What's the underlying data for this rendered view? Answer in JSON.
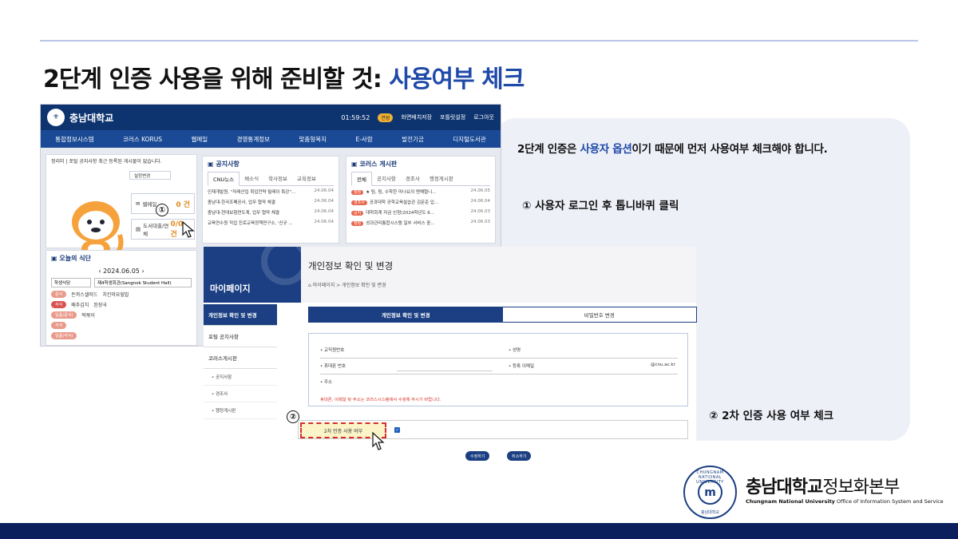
{
  "slide": {
    "title_prefix": "2단계 인증 사용을 위해 준비할 것: ",
    "title_highlight": "사용여부 체크"
  },
  "info": {
    "main_prefix": "2단계 인증은 ",
    "main_highlight": "사용자 옵션",
    "main_suffix": "이기 때문에 먼저 사용여부 체크해야 합니다.",
    "step1": "① 사용자 로그인 후 톱니바퀴 클릭",
    "step2": "② 2차 인증 사용 여부 체크"
  },
  "portal": {
    "univ_name": "충남대학교",
    "clock": "01:59:52",
    "extend": "연장",
    "header_links": [
      "화면배치저장",
      "포틀릿설정",
      "로그아웃"
    ],
    "nav": [
      "통합정보시스템",
      "코러스 KORUS",
      "웹메일",
      "경영통계정보",
      "맞춤형복지",
      "E-사람",
      "발전기금",
      "디지털도서관"
    ],
    "user_notice": "정리미 | 포털 공지사항 최근 등록된 게시물이 없습니다.",
    "step_marker": "①",
    "mail_label": "웹메일",
    "mail_count": "0 건",
    "library_label": "도서대출/연체",
    "library_count": "0/0 건",
    "settings_label": "설정변경",
    "notice": {
      "title": "공지사항",
      "tabs": [
        "CNU뉴스",
        "채소식",
        "학사정보",
        "교육정보"
      ],
      "rows": [
        {
          "text": "인재개발원, \"미래산업 취업전략 릴레이 특강\"...",
          "date": "24.06.04"
        },
        {
          "text": "충남대-한국조폐공사, 업무 협약 체결",
          "date": "24.06.04"
        },
        {
          "text": "충남대-현대보험연도계, 업무 협약 체결",
          "date": "24.06.04"
        },
        {
          "text": "교육연수원 직업 진로교육정책연구소, '신규 ...",
          "date": "24.06.04"
        }
      ]
    },
    "korus": {
      "title": "코러스 게시판",
      "tabs": [
        "전체",
        "공지사항",
        "경조사",
        "행정게시판"
      ],
      "rows": [
        {
          "badge": "행정",
          "text": "★ 팀, 팀, 수학한 미나요의 맨해협니...",
          "date": "24.06.05"
        },
        {
          "badge": "경조사",
          "text": "공과대학 공학교육설습관 김문준 입...",
          "date": "24.06.04"
        },
        {
          "badge": "공지",
          "text": "대학회계 자금 신청(2024학년도 6...",
          "date": "24.06.03"
        },
        {
          "badge": "행정",
          "text": "성과관리통합시스템 일부 서비스 중...",
          "date": "24.06.03"
        }
      ]
    },
    "meal": {
      "title": "오늘의 식단",
      "date": "2024.06.05",
      "place": "학생식당",
      "hall": "제4학생회관(Sangnok Student Hall)",
      "tags": [
        "중식",
        "석식",
        "일품(중식)",
        "석식",
        "일품(석식)"
      ],
      "items_left": [
        "돈까스샐러드",
        "배추김치",
        "떡볶이"
      ],
      "items_right": [
        "치킨마요덮밥",
        "된장국"
      ]
    }
  },
  "mypage": {
    "side_title": "마이페이지",
    "page_title": "개인정보 확인 및 변경",
    "breadcrumb": "마이페이지 > 개인정보 확인 및 변경",
    "menu": [
      {
        "label": "개인정보 확인 및 변경",
        "active": true
      },
      {
        "label": "포털 공지사항",
        "active": false
      },
      {
        "label": "코러스게시판",
        "active": false
      }
    ],
    "submenu": [
      "공지사항",
      "경조사",
      "행정게시판"
    ],
    "tabs": [
      "개인정보 확인 및 변경",
      "비밀번호 변경"
    ],
    "fields": {
      "staff_no": "교직원번호",
      "name": "성명",
      "phone": "휴대폰 번호",
      "email": "등록 이메일",
      "email_domain": "@cnu.ac.kr",
      "address": "주소"
    },
    "warning": "휴대폰, 이메일 및 주소는 코러스시스템에서 수정해 주시기 바랍니다.",
    "step_marker": "②",
    "twofa_label": "2차 인증 사용 여부",
    "buttons": [
      "수정하기",
      "취소하기"
    ]
  },
  "footer": {
    "univ": "충남대학교",
    "dept": "정보화본부",
    "univ_en": "Chungnam National University",
    "dept_en": "Office of Information System and Service",
    "seal_top": "CHUNGNAM NATIONAL UNIVERSITY",
    "seal_bottom": "충남대학교"
  },
  "colors": {
    "accent": "#1f4aa8",
    "navy": "#0a1f5c",
    "panel_bg": "#eef0f8",
    "highlight_border": "#d62c2c"
  }
}
